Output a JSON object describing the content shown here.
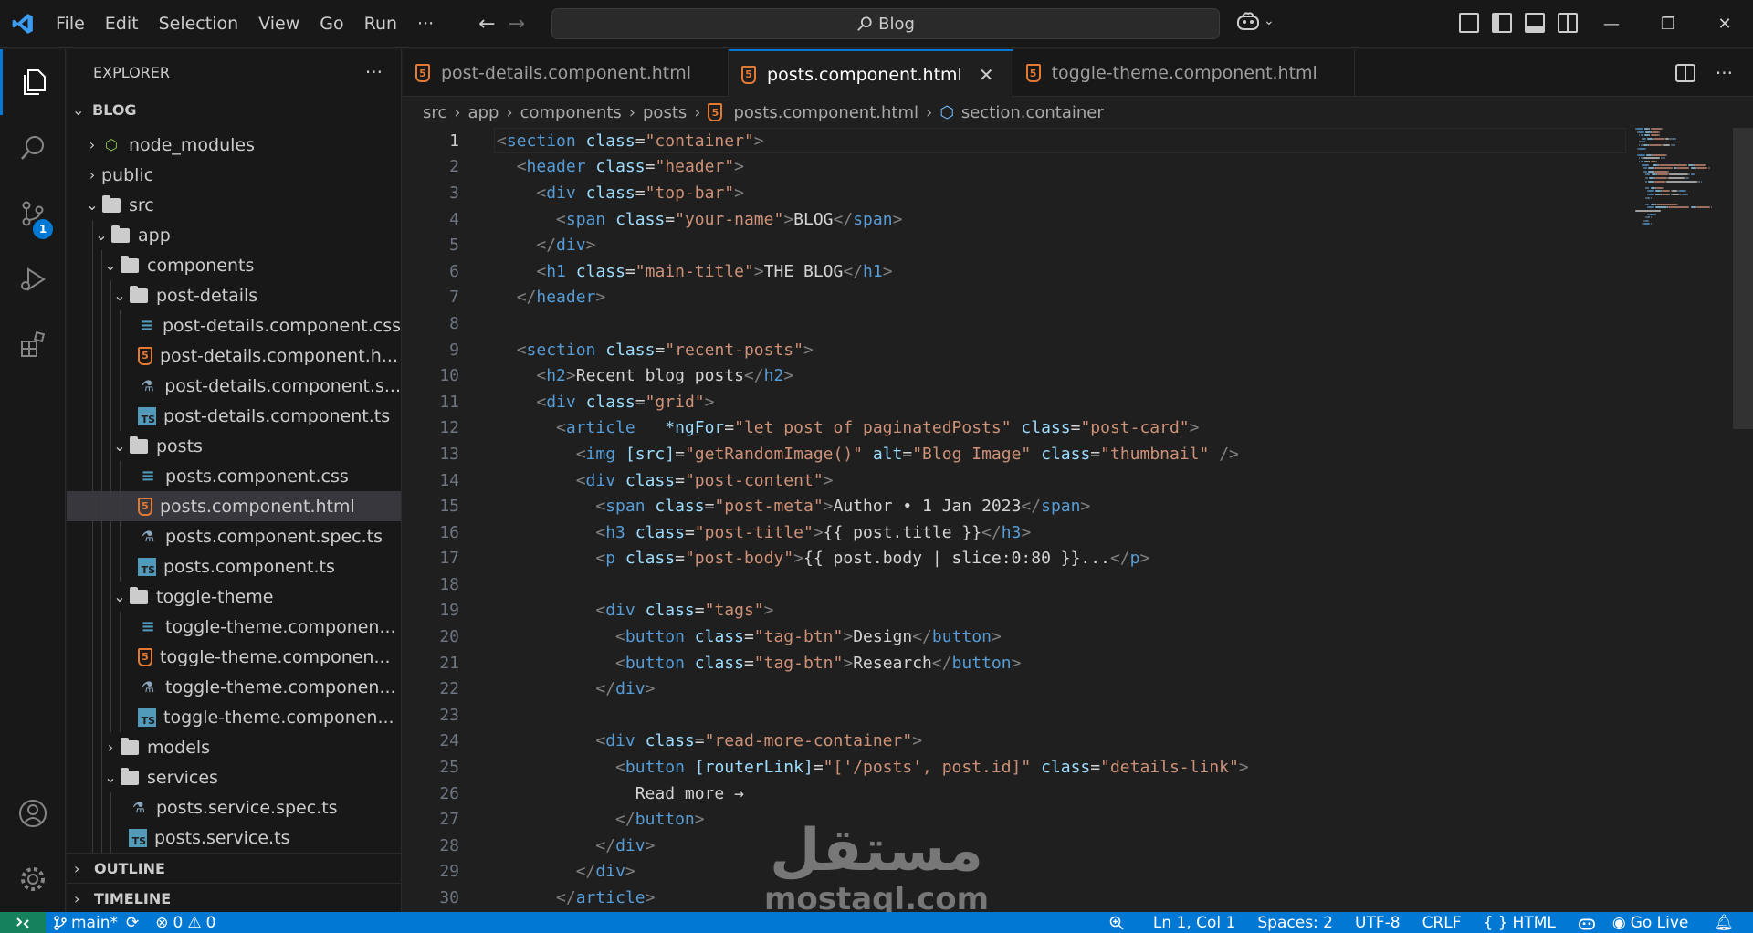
{
  "titlebar": {
    "menu": [
      "File",
      "Edit",
      "Selection",
      "View",
      "Go",
      "Run",
      "···"
    ],
    "search": "Blog"
  },
  "activity": {
    "scm_badge": "1"
  },
  "sidebar": {
    "header": "EXPLORER",
    "more": "···",
    "root": "BLOG",
    "tree": [
      {
        "label": "node_modules",
        "kind": "node",
        "depth": 1,
        "chev": "›"
      },
      {
        "label": "public",
        "kind": "none",
        "depth": 1,
        "chev": "›"
      },
      {
        "label": "src",
        "kind": "folder",
        "depth": 1,
        "chev": "⌄"
      },
      {
        "label": "app",
        "kind": "folder",
        "depth": 2,
        "chev": "⌄"
      },
      {
        "label": "components",
        "kind": "folder",
        "depth": 3,
        "chev": "⌄"
      },
      {
        "label": "post-details",
        "kind": "folder",
        "depth": 4,
        "chev": "⌄"
      },
      {
        "label": "post-details.component.css",
        "kind": "css",
        "depth": 5,
        "chev": ""
      },
      {
        "label": "post-details.component.h...",
        "kind": "html",
        "depth": 5,
        "chev": ""
      },
      {
        "label": "post-details.component.s...",
        "kind": "spec",
        "depth": 5,
        "chev": ""
      },
      {
        "label": "post-details.component.ts",
        "kind": "ts",
        "depth": 5,
        "chev": ""
      },
      {
        "label": "posts",
        "kind": "folder",
        "depth": 4,
        "chev": "⌄"
      },
      {
        "label": "posts.component.css",
        "kind": "css",
        "depth": 5,
        "chev": ""
      },
      {
        "label": "posts.component.html",
        "kind": "html",
        "depth": 5,
        "chev": "",
        "selected": true
      },
      {
        "label": "posts.component.spec.ts",
        "kind": "spec",
        "depth": 5,
        "chev": ""
      },
      {
        "label": "posts.component.ts",
        "kind": "ts",
        "depth": 5,
        "chev": ""
      },
      {
        "label": "toggle-theme",
        "kind": "folder",
        "depth": 4,
        "chev": "⌄"
      },
      {
        "label": "toggle-theme.componen...",
        "kind": "css",
        "depth": 5,
        "chev": ""
      },
      {
        "label": "toggle-theme.componen...",
        "kind": "html",
        "depth": 5,
        "chev": ""
      },
      {
        "label": "toggle-theme.componen...",
        "kind": "spec",
        "depth": 5,
        "chev": ""
      },
      {
        "label": "toggle-theme.componen...",
        "kind": "ts",
        "depth": 5,
        "chev": ""
      },
      {
        "label": "models",
        "kind": "folder",
        "depth": 3,
        "chev": "›"
      },
      {
        "label": "services",
        "kind": "folder",
        "depth": 3,
        "chev": "⌄"
      },
      {
        "label": "posts.service.spec.ts",
        "kind": "spec",
        "depth": 4,
        "chev": ""
      },
      {
        "label": "posts.service.ts",
        "kind": "ts",
        "depth": 4,
        "chev": ""
      }
    ],
    "outline": "OUTLINE",
    "timeline": "TIMELINE"
  },
  "tabs": [
    {
      "label": "post-details.component.html",
      "active": false
    },
    {
      "label": "posts.component.html",
      "active": true
    },
    {
      "label": "toggle-theme.component.html",
      "active": false
    }
  ],
  "breadcrumb": [
    "src",
    "app",
    "components",
    "posts",
    "posts.component.html",
    "section.container"
  ],
  "code": [
    [
      [
        "pun",
        "<"
      ],
      [
        "tag",
        "section"
      ],
      [
        "txt",
        " "
      ],
      [
        "attr",
        "class"
      ],
      [
        "txt",
        "="
      ],
      [
        "str",
        "\"container\""
      ],
      [
        "pun",
        ">"
      ]
    ],
    [
      [
        "txt",
        "  "
      ],
      [
        "pun",
        "<"
      ],
      [
        "tag",
        "header"
      ],
      [
        "txt",
        " "
      ],
      [
        "attr",
        "class"
      ],
      [
        "txt",
        "="
      ],
      [
        "str",
        "\"header\""
      ],
      [
        "pun",
        ">"
      ]
    ],
    [
      [
        "txt",
        "    "
      ],
      [
        "pun",
        "<"
      ],
      [
        "tag",
        "div"
      ],
      [
        "txt",
        " "
      ],
      [
        "attr",
        "class"
      ],
      [
        "txt",
        "="
      ],
      [
        "str",
        "\"top-bar\""
      ],
      [
        "pun",
        ">"
      ]
    ],
    [
      [
        "txt",
        "      "
      ],
      [
        "pun",
        "<"
      ],
      [
        "tag",
        "span"
      ],
      [
        "txt",
        " "
      ],
      [
        "attr",
        "class"
      ],
      [
        "txt",
        "="
      ],
      [
        "str",
        "\"your-name\""
      ],
      [
        "pun",
        ">"
      ],
      [
        "txt",
        "BLOG"
      ],
      [
        "pun",
        "</"
      ],
      [
        "tag",
        "span"
      ],
      [
        "pun",
        ">"
      ]
    ],
    [
      [
        "txt",
        "    "
      ],
      [
        "pun",
        "</"
      ],
      [
        "tag",
        "div"
      ],
      [
        "pun",
        ">"
      ]
    ],
    [
      [
        "txt",
        "    "
      ],
      [
        "pun",
        "<"
      ],
      [
        "tag",
        "h1"
      ],
      [
        "txt",
        " "
      ],
      [
        "attr",
        "class"
      ],
      [
        "txt",
        "="
      ],
      [
        "str",
        "\"main-title\""
      ],
      [
        "pun",
        ">"
      ],
      [
        "txt",
        "THE BLOG"
      ],
      [
        "pun",
        "</"
      ],
      [
        "tag",
        "h1"
      ],
      [
        "pun",
        ">"
      ]
    ],
    [
      [
        "txt",
        "  "
      ],
      [
        "pun",
        "</"
      ],
      [
        "tag",
        "header"
      ],
      [
        "pun",
        ">"
      ]
    ],
    [],
    [
      [
        "txt",
        "  "
      ],
      [
        "pun",
        "<"
      ],
      [
        "tag",
        "section"
      ],
      [
        "txt",
        " "
      ],
      [
        "attr",
        "class"
      ],
      [
        "txt",
        "="
      ],
      [
        "str",
        "\"recent-posts\""
      ],
      [
        "pun",
        ">"
      ]
    ],
    [
      [
        "txt",
        "    "
      ],
      [
        "pun",
        "<"
      ],
      [
        "tag",
        "h2"
      ],
      [
        "pun",
        ">"
      ],
      [
        "txt",
        "Recent blog posts"
      ],
      [
        "pun",
        "</"
      ],
      [
        "tag",
        "h2"
      ],
      [
        "pun",
        ">"
      ]
    ],
    [
      [
        "txt",
        "    "
      ],
      [
        "pun",
        "<"
      ],
      [
        "tag",
        "div"
      ],
      [
        "txt",
        " "
      ],
      [
        "attr",
        "class"
      ],
      [
        "txt",
        "="
      ],
      [
        "str",
        "\"grid\""
      ],
      [
        "pun",
        ">"
      ]
    ],
    [
      [
        "txt",
        "      "
      ],
      [
        "pun",
        "<"
      ],
      [
        "tag",
        "article"
      ],
      [
        "txt",
        "   "
      ],
      [
        "attr",
        "*ngFor"
      ],
      [
        "txt",
        "="
      ],
      [
        "str",
        "\"let post of paginatedPosts\""
      ],
      [
        "txt",
        " "
      ],
      [
        "attr",
        "class"
      ],
      [
        "txt",
        "="
      ],
      [
        "str",
        "\"post-card\""
      ],
      [
        "pun",
        ">"
      ]
    ],
    [
      [
        "txt",
        "        "
      ],
      [
        "pun",
        "<"
      ],
      [
        "tag",
        "img"
      ],
      [
        "txt",
        " "
      ],
      [
        "attr",
        "[src]"
      ],
      [
        "txt",
        "="
      ],
      [
        "str",
        "\"getRandomImage()\""
      ],
      [
        "txt",
        " "
      ],
      [
        "attr",
        "alt"
      ],
      [
        "txt",
        "="
      ],
      [
        "str",
        "\"Blog Image\""
      ],
      [
        "txt",
        " "
      ],
      [
        "attr",
        "class"
      ],
      [
        "txt",
        "="
      ],
      [
        "str",
        "\"thumbnail\""
      ],
      [
        "txt",
        " "
      ],
      [
        "pun",
        "/>"
      ]
    ],
    [
      [
        "txt",
        "        "
      ],
      [
        "pun",
        "<"
      ],
      [
        "tag",
        "div"
      ],
      [
        "txt",
        " "
      ],
      [
        "attr",
        "class"
      ],
      [
        "txt",
        "="
      ],
      [
        "str",
        "\"post-content\""
      ],
      [
        "pun",
        ">"
      ]
    ],
    [
      [
        "txt",
        "          "
      ],
      [
        "pun",
        "<"
      ],
      [
        "tag",
        "span"
      ],
      [
        "txt",
        " "
      ],
      [
        "attr",
        "class"
      ],
      [
        "txt",
        "="
      ],
      [
        "str",
        "\"post-meta\""
      ],
      [
        "pun",
        ">"
      ],
      [
        "txt",
        "Author • 1 Jan 2023"
      ],
      [
        "pun",
        "</"
      ],
      [
        "tag",
        "span"
      ],
      [
        "pun",
        ">"
      ]
    ],
    [
      [
        "txt",
        "          "
      ],
      [
        "pun",
        "<"
      ],
      [
        "tag",
        "h3"
      ],
      [
        "txt",
        " "
      ],
      [
        "attr",
        "class"
      ],
      [
        "txt",
        "="
      ],
      [
        "str",
        "\"post-title\""
      ],
      [
        "pun",
        ">"
      ],
      [
        "txt",
        "{{ post.title }}"
      ],
      [
        "pun",
        "</"
      ],
      [
        "tag",
        "h3"
      ],
      [
        "pun",
        ">"
      ]
    ],
    [
      [
        "txt",
        "          "
      ],
      [
        "pun",
        "<"
      ],
      [
        "tag",
        "p"
      ],
      [
        "txt",
        " "
      ],
      [
        "attr",
        "class"
      ],
      [
        "txt",
        "="
      ],
      [
        "str",
        "\"post-body\""
      ],
      [
        "pun",
        ">"
      ],
      [
        "txt",
        "{{ post.body | slice:0:80 }}..."
      ],
      [
        "pun",
        "</"
      ],
      [
        "tag",
        "p"
      ],
      [
        "pun",
        ">"
      ]
    ],
    [],
    [
      [
        "txt",
        "          "
      ],
      [
        "pun",
        "<"
      ],
      [
        "tag",
        "div"
      ],
      [
        "txt",
        " "
      ],
      [
        "attr",
        "class"
      ],
      [
        "txt",
        "="
      ],
      [
        "str",
        "\"tags\""
      ],
      [
        "pun",
        ">"
      ]
    ],
    [
      [
        "txt",
        "            "
      ],
      [
        "pun",
        "<"
      ],
      [
        "tag",
        "button"
      ],
      [
        "txt",
        " "
      ],
      [
        "attr",
        "class"
      ],
      [
        "txt",
        "="
      ],
      [
        "str",
        "\"tag-btn\""
      ],
      [
        "pun",
        ">"
      ],
      [
        "txt",
        "Design"
      ],
      [
        "pun",
        "</"
      ],
      [
        "tag",
        "button"
      ],
      [
        "pun",
        ">"
      ]
    ],
    [
      [
        "txt",
        "            "
      ],
      [
        "pun",
        "<"
      ],
      [
        "tag",
        "button"
      ],
      [
        "txt",
        " "
      ],
      [
        "attr",
        "class"
      ],
      [
        "txt",
        "="
      ],
      [
        "str",
        "\"tag-btn\""
      ],
      [
        "pun",
        ">"
      ],
      [
        "txt",
        "Research"
      ],
      [
        "pun",
        "</"
      ],
      [
        "tag",
        "button"
      ],
      [
        "pun",
        ">"
      ]
    ],
    [
      [
        "txt",
        "          "
      ],
      [
        "pun",
        "</"
      ],
      [
        "tag",
        "div"
      ],
      [
        "pun",
        ">"
      ]
    ],
    [],
    [
      [
        "txt",
        "          "
      ],
      [
        "pun",
        "<"
      ],
      [
        "tag",
        "div"
      ],
      [
        "txt",
        " "
      ],
      [
        "attr",
        "class"
      ],
      [
        "txt",
        "="
      ],
      [
        "str",
        "\"read-more-container\""
      ],
      [
        "pun",
        ">"
      ]
    ],
    [
      [
        "txt",
        "            "
      ],
      [
        "pun",
        "<"
      ],
      [
        "tag",
        "button"
      ],
      [
        "txt",
        " "
      ],
      [
        "attr",
        "[routerLink]"
      ],
      [
        "txt",
        "="
      ],
      [
        "str",
        "\"['/posts', post.id]\""
      ],
      [
        "txt",
        " "
      ],
      [
        "attr",
        "class"
      ],
      [
        "txt",
        "="
      ],
      [
        "str",
        "\"details-link\""
      ],
      [
        "pun",
        ">"
      ]
    ],
    [
      [
        "txt",
        "              Read more →"
      ]
    ],
    [
      [
        "txt",
        "            "
      ],
      [
        "pun",
        "</"
      ],
      [
        "tag",
        "button"
      ],
      [
        "pun",
        ">"
      ]
    ],
    [
      [
        "txt",
        "          "
      ],
      [
        "pun",
        "</"
      ],
      [
        "tag",
        "div"
      ],
      [
        "pun",
        ">"
      ]
    ],
    [
      [
        "txt",
        "        "
      ],
      [
        "pun",
        "</"
      ],
      [
        "tag",
        "div"
      ],
      [
        "pun",
        ">"
      ]
    ],
    [
      [
        "txt",
        "      "
      ],
      [
        "pun",
        "</"
      ],
      [
        "tag",
        "article"
      ],
      [
        "pun",
        ">"
      ]
    ]
  ],
  "watermark": {
    "arabic": "مستقل",
    "latin": "mostaql.com"
  },
  "status": {
    "branch": "main*",
    "errors": "0",
    "warnings": "0",
    "position": "Ln 1, Col 1",
    "spaces": "Spaces: 2",
    "encoding": "UTF-8",
    "eol": "CRLF",
    "language": "HTML",
    "live": "Go Live"
  },
  "colors": {
    "accent": "#0078d4",
    "html_icon": "#e37933",
    "ts_icon": "#519aba",
    "tag": "#569cd6",
    "attribute": "#9cdcfe",
    "string": "#ce9178"
  }
}
